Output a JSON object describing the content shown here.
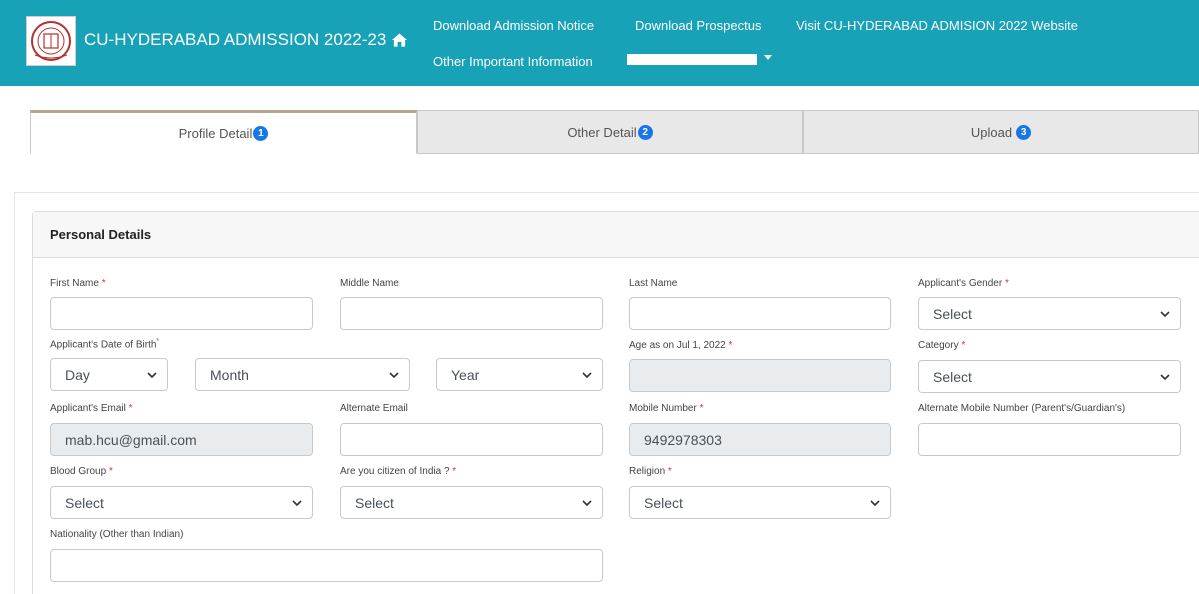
{
  "header": {
    "brand": "CU-HYDERABAD ADMISSION 2022-23",
    "links": {
      "admission_notice": "Download Admission Notice",
      "prospectus": "Download Prospectus",
      "website": "Visit CU-HYDERABAD ADMISION 2022 Website",
      "other_info": "Other Important Information"
    },
    "icons": {
      "home": "home-icon",
      "user_dropdown": "chevron-down-icon"
    }
  },
  "tabs": [
    {
      "label": "Profile Detail",
      "num": "1",
      "active": true
    },
    {
      "label": "Other Detail",
      "num": "2",
      "active": false
    },
    {
      "label": "Upload",
      "num": "3",
      "active": false
    }
  ],
  "section": {
    "title": "Personal Details"
  },
  "form": {
    "first_name": {
      "label": "First Name",
      "required": "*",
      "value": ""
    },
    "middle_name": {
      "label": "Middle Name",
      "value": ""
    },
    "last_name": {
      "label": "Last Name",
      "value": ""
    },
    "gender": {
      "label": "Applicant's Gender",
      "required": "*",
      "value": "Select"
    },
    "dob": {
      "label": "Applicant's Date of Birth",
      "required": "*",
      "day": "Day",
      "month": "Month",
      "year": "Year"
    },
    "age": {
      "label": "Age as on Jul 1, 2022",
      "required": "*",
      "value": ""
    },
    "category": {
      "label": "Category",
      "required": "*",
      "value": "Select"
    },
    "email": {
      "label": "Applicant's Email",
      "required": "*",
      "value": "mab.hcu@gmail.com"
    },
    "alt_email": {
      "label": "Alternate Email",
      "value": ""
    },
    "mobile": {
      "label": "Mobile Number",
      "required": "*",
      "value": "9492978303"
    },
    "alt_mobile": {
      "label": "Alternate Mobile Number (Parent's/Guardian's)",
      "value": ""
    },
    "blood_group": {
      "label": "Blood Group",
      "required": "*",
      "value": "Select"
    },
    "citizen": {
      "label": "Are you citizen of India ?",
      "required": "*",
      "value": "Select"
    },
    "religion": {
      "label": "Religion",
      "required": "*",
      "value": "Select"
    },
    "nationality": {
      "label": "Nationality (Other than Indian)",
      "value": ""
    }
  },
  "colors": {
    "navbar": "#17a2b8",
    "badge": "#1877e8",
    "required": "#e03030"
  }
}
